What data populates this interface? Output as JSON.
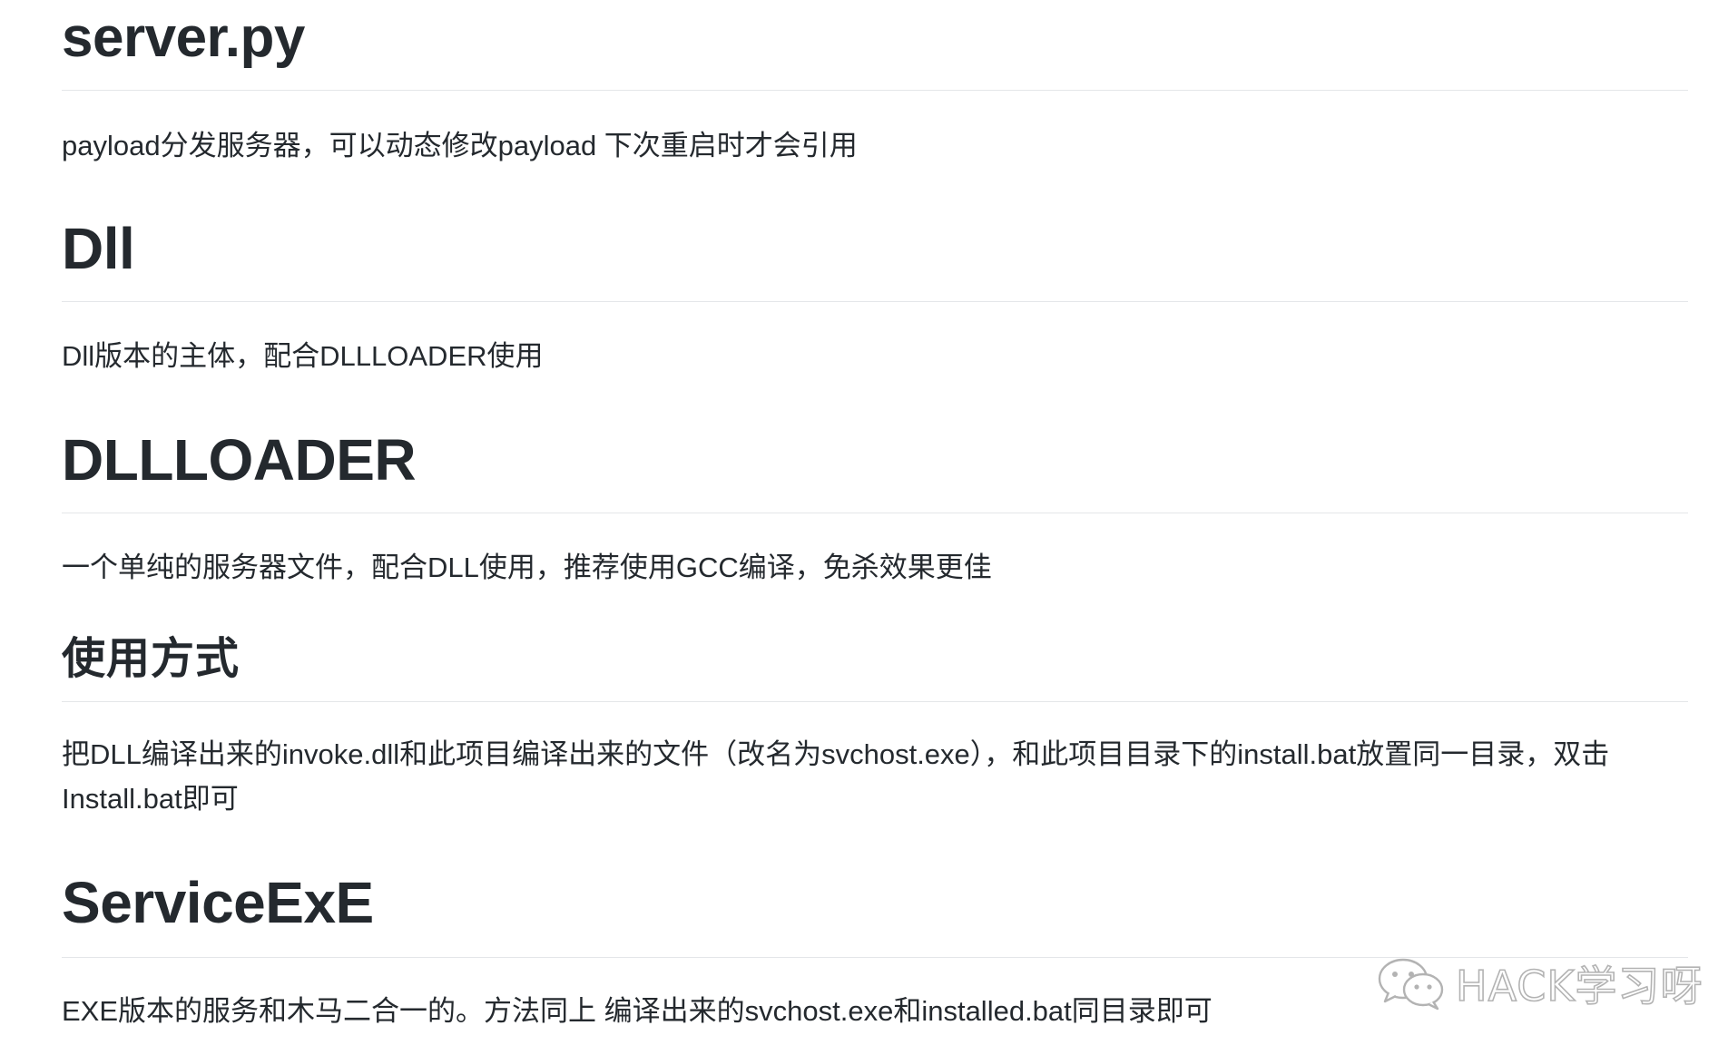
{
  "sections": [
    {
      "title": "server.py",
      "text": "payload分发服务器，可以动态修改payload 下次重启时才会引用"
    },
    {
      "title": "Dll",
      "text": "Dll版本的主体，配合DLLLOADER使用"
    },
    {
      "title": "DLLLOADER",
      "text": "一个单纯的服务器文件，配合DLL使用，推荐使用GCC编译，免杀效果更佳"
    },
    {
      "title": "使用方式",
      "text": "把DLL编译出来的invoke.dll和此项目编译出来的文件（改名为svchost.exe），和此项目目录下的install.bat放置同一目录，双击Install.bat即可"
    },
    {
      "title": "ServiceExE",
      "text": "EXE版本的服务和木马二合一的。方法同上 编译出来的svchost.exe和installed.bat同目录即可"
    }
  ],
  "watermark": {
    "text": "HACK学习呀",
    "icon": "wechat-icon"
  },
  "colors": {
    "text": "#24292e",
    "rule": "#e4e6e9",
    "background": "#ffffff",
    "watermark_outline": "#9a9a9a"
  }
}
